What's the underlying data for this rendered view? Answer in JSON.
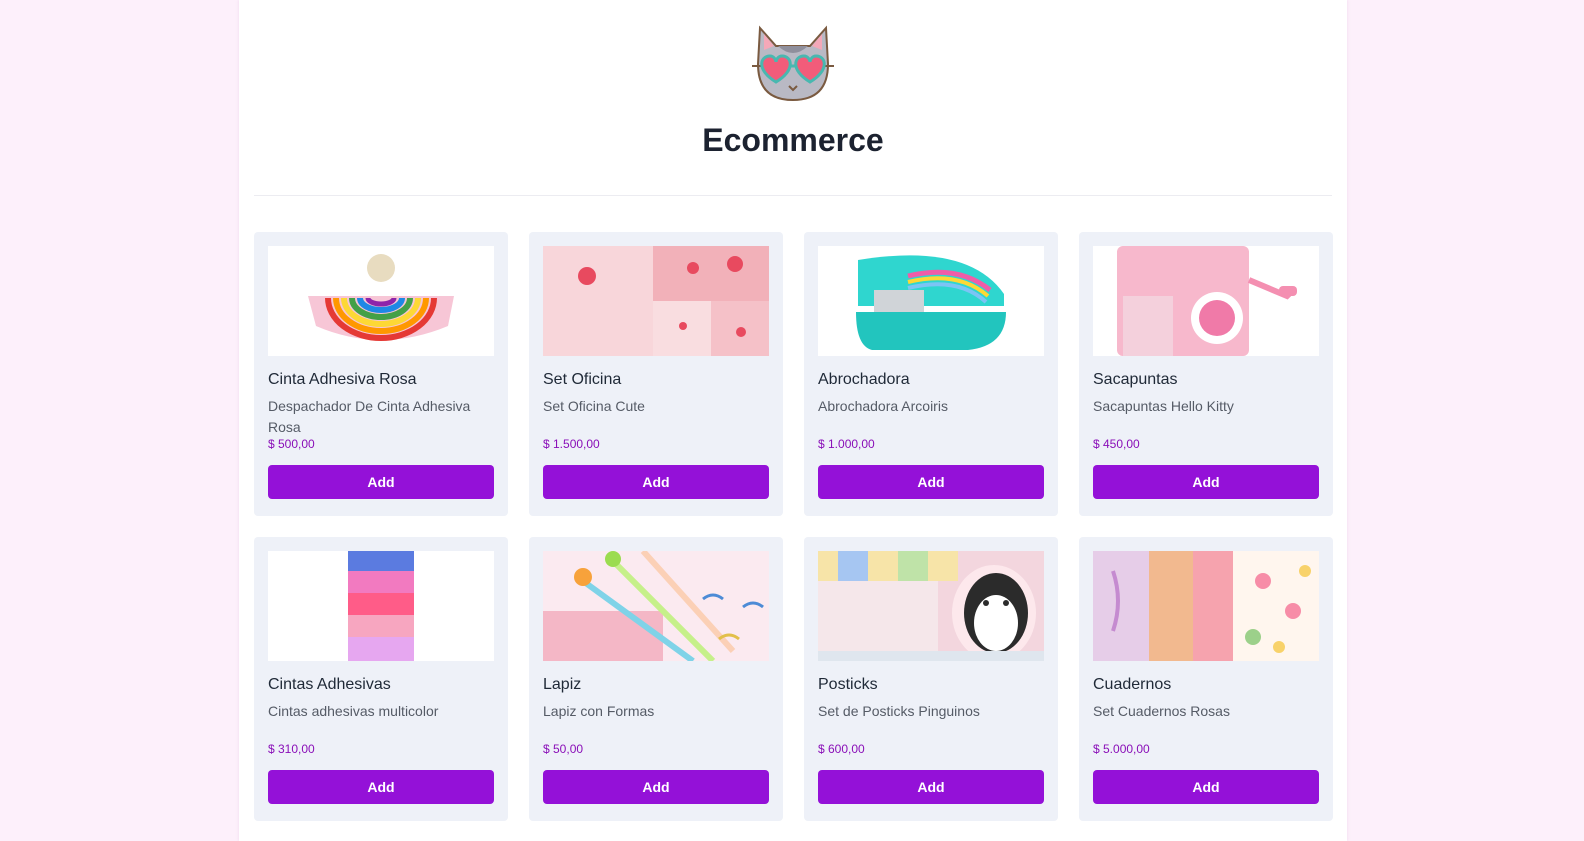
{
  "header": {
    "title": "Ecommerce",
    "logo_icon": "cat-with-heart-glasses-icon"
  },
  "colors": {
    "accent": "#9411d8",
    "price": "#8a0fb8",
    "card_bg": "#eef1f8",
    "page_bg": "#fdf0fb"
  },
  "products": [
    {
      "name": "Cinta Adhesiva Rosa",
      "description": "Despachador De Cinta Adhesiva Rosa",
      "price": "$ 500,00",
      "button": "Add",
      "image": "rainbow-tape-dispenser"
    },
    {
      "name": "Set Oficina",
      "description": "Set Oficina Cute",
      "price": "$ 1.500,00",
      "button": "Add",
      "image": "strawberry-office-set"
    },
    {
      "name": "Abrochadora",
      "description": "Abrochadora Arcoiris",
      "price": "$ 1.000,00",
      "button": "Add",
      "image": "rainbow-stapler"
    },
    {
      "name": "Sacapuntas",
      "description": "Sacapuntas Hello Kitty",
      "price": "$ 450,00",
      "button": "Add",
      "image": "hello-kitty-sharpener"
    },
    {
      "name": "Cintas Adhesivas",
      "description": "Cintas adhesivas multicolor",
      "price": "$ 310,00",
      "button": "Add",
      "image": "multicolor-tapes"
    },
    {
      "name": "Lapiz",
      "description": "Lapiz con Formas",
      "price": "$ 50,00",
      "button": "Add",
      "image": "shaped-pencils"
    },
    {
      "name": "Posticks",
      "description": "Set de Posticks Pinguinos",
      "price": "$ 600,00",
      "button": "Add",
      "image": "penguin-posticks"
    },
    {
      "name": "Cuadernos",
      "description": "Set Cuadernos Rosas",
      "price": "$ 5.000,00",
      "button": "Add",
      "image": "pink-notebooks"
    }
  ]
}
